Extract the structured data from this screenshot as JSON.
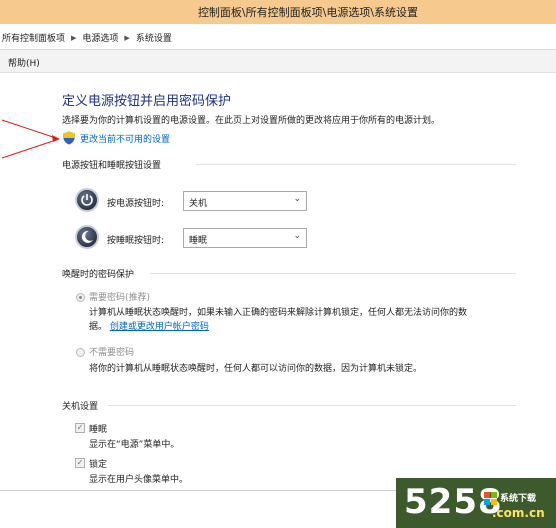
{
  "window": {
    "title": "控制面板\\所有控制面板项\\电源选项\\系统设置"
  },
  "breadcrumb": {
    "items": [
      "所有控制面板项",
      "电源选项",
      "系统设置"
    ]
  },
  "menu": {
    "help": "帮助(H)"
  },
  "main": {
    "title": "定义电源按钮并启用密码保护",
    "description": "选择要为你的计算机设置的电源设置。在此页上对设置所做的更改将应用于你所有的电源计划。",
    "change_link": "更改当前不可用的设置"
  },
  "buttons_section": {
    "header": "电源按钮和睡眠按钮设置",
    "power_label": "按电源按钮时:",
    "power_value": "关机",
    "sleep_label": "按睡眠按钮时:",
    "sleep_value": "睡眠"
  },
  "password_section": {
    "header": "唤醒时的密码保护",
    "require_label": "需要密码(推荐)",
    "require_desc": "计算机从睡眠状态唤醒时，如果未输入正确的密码来解除计算机锁定，任何人都无法访问你的数",
    "require_desc2": "据。",
    "create_link": "创建或更改用户帐户密码",
    "norequire_label": "不需要密码",
    "norequire_desc": "将你的计算机从睡眠状态唤醒时，任何人都可以访问你的数据，因为计算机未锁定。"
  },
  "shutdown_section": {
    "header": "关机设置",
    "sleep_label": "睡眠",
    "sleep_desc": "显示在“电源”菜单中。",
    "lock_label": "锁定",
    "lock_desc": "显示在用户头像菜单中。"
  },
  "watermark": {
    "number": "5258",
    "name": "系统下载",
    "domain": ".com.cn"
  },
  "colors": {
    "title_bar": "#f6c98e",
    "heading": "#1e3287",
    "link": "#0066cc",
    "arrow": "#d81e1e",
    "watermark_bg": "#3d5a2c"
  }
}
